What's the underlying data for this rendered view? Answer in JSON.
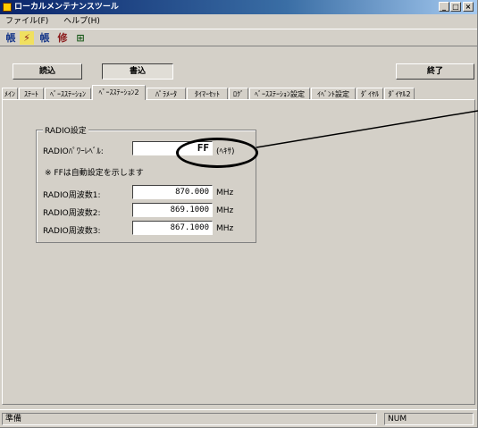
{
  "window": {
    "title": "ローカルメンテナンスツール",
    "minimize_label": "_",
    "maximize_label": "□",
    "close_label": "×"
  },
  "menu": {
    "items": [
      "ファイル(F)",
      "ヘルプ(H)"
    ]
  },
  "toolbar": {
    "icons": [
      "book-icon",
      "lightning-icon",
      "book-icon",
      "wrench-icon",
      "chart-icon"
    ],
    "glyphs": [
      "帳",
      "⚡",
      "帳",
      "修",
      "⊞"
    ]
  },
  "commands": {
    "read": "読込",
    "write": "書込",
    "exit": "終了"
  },
  "tabs": [
    "ﾒｲﾝ",
    "ｽﾃｰﾄ",
    "ﾍﾞｰｽｽﾃｰｼｮﾝ",
    "ﾍﾞｰｽｽﾃｰｼｮﾝ2",
    "ﾊﾟﾗﾒｰﾀ",
    "ﾀｲﾏｰｾｯﾄ",
    "ﾛｸﾞ",
    "ﾍﾞｰｽｽﾃｰｼｮﾝ設定",
    "ｲﾍﾞﾝﾄ設定",
    "ﾀﾞｲﾔﾙ",
    "ﾀﾞｲﾔﾙ2"
  ],
  "active_tab_index": 3,
  "group": {
    "title": "RADIO設定",
    "radio_power_label": "RADIOﾊﾟﾜｰﾚﾍﾞﾙ:",
    "radio_power_value": "FF",
    "radio_power_unit": "(ﾍｷｻ)",
    "note": "※ FFは自動設定を示します",
    "freq1_label": "RADIO周波数1:",
    "freq1_value": "870.000",
    "freq1_unit": "MHz",
    "freq2_label": "RADIO周波数2:",
    "freq2_value": "869.1000",
    "freq2_unit": "MHz",
    "freq3_label": "RADIO周波数3:",
    "freq3_value": "867.1000",
    "freq3_unit": "MHz"
  },
  "status": {
    "left": "準備",
    "right": "NUM"
  }
}
